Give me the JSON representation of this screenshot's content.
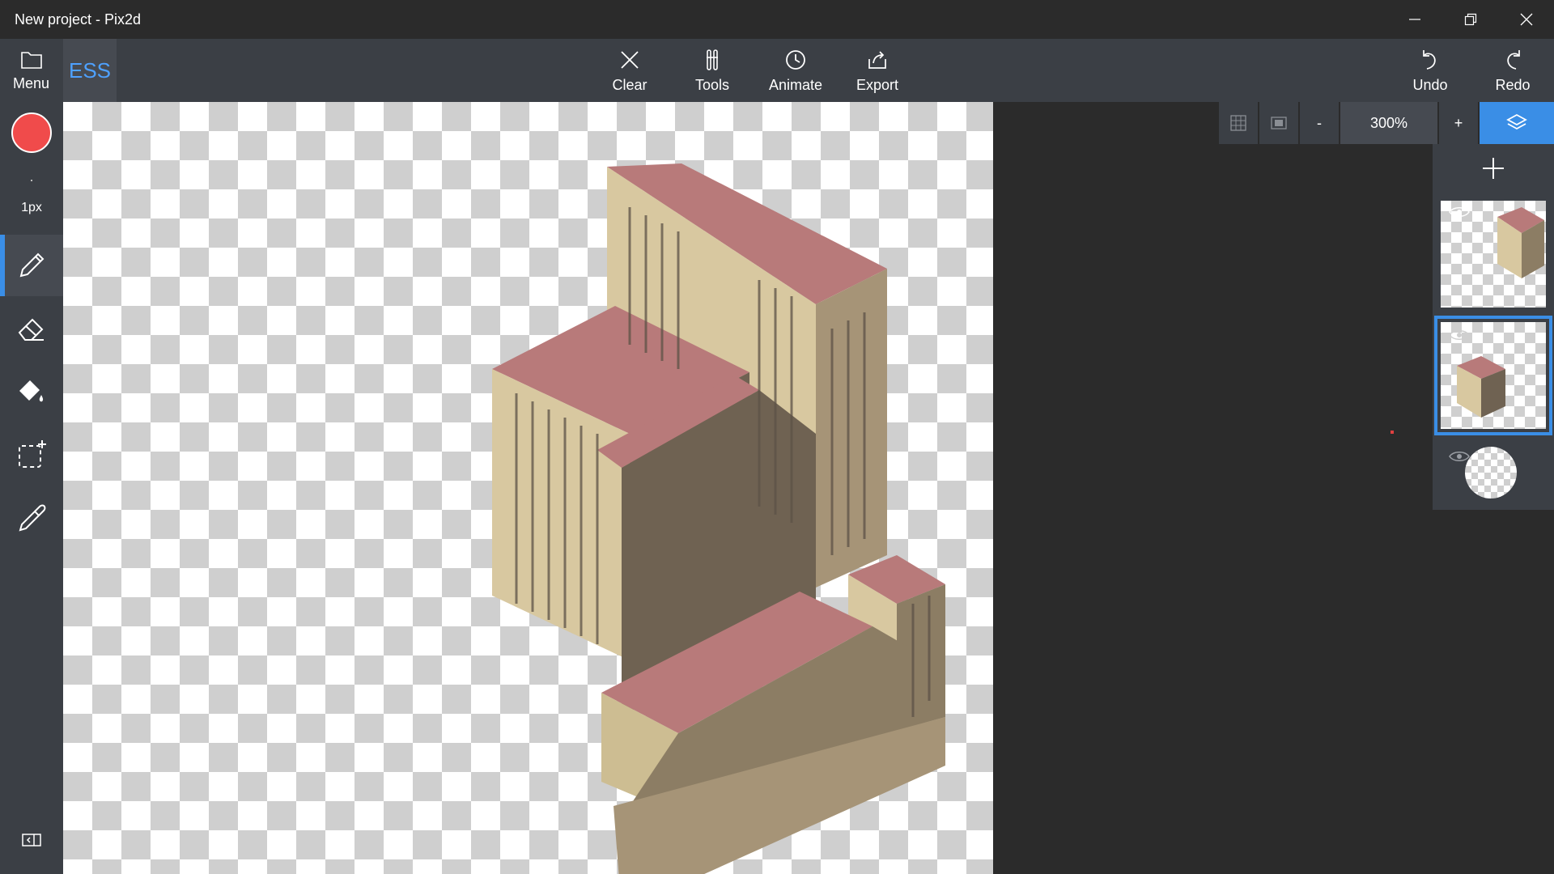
{
  "window": {
    "title": "New project - Pix2d"
  },
  "toolbar": {
    "menu_label": "Menu",
    "ess_label": "ESS",
    "clear_label": "Clear",
    "tools_label": "Tools",
    "animate_label": "Animate",
    "export_label": "Export",
    "undo_label": "Undo",
    "redo_label": "Redo"
  },
  "brush": {
    "color": "#f04b4b",
    "size_label": "1px"
  },
  "tools": [
    "pencil-icon",
    "eraser-icon",
    "fill-bucket-icon",
    "selection-icon",
    "eyedropper-icon"
  ],
  "zoom": {
    "minus_label": "-",
    "value": "300%",
    "plus_label": "+"
  },
  "colors": {
    "accent": "#3a8ee6",
    "roof": "#b87a7a",
    "facade": "#d8c8a0",
    "shadow": "#8c7d64"
  }
}
